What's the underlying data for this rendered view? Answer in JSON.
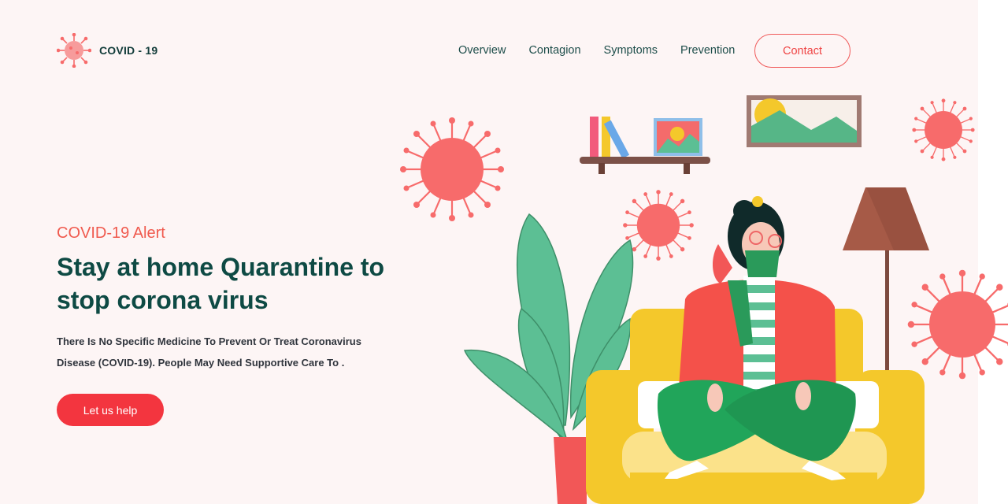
{
  "brand": {
    "name": "COVID - 19",
    "logo_icon": "virus-icon"
  },
  "nav": {
    "items": [
      "Overview",
      "Contagion",
      "Symptoms",
      "Prevention"
    ],
    "contact_label": "Contact"
  },
  "hero": {
    "eyebrow": "COVID-19 Alert",
    "title": "Stay at home Quarantine to stop corona virus",
    "description": "There Is No Specific Medicine To Prevent Or Treat Coronavirus Disease (COVID-19). People May Need Supportive Care To .",
    "cta_label": "Let us help"
  },
  "colors": {
    "accent": "#f3353f",
    "heading": "#0e4a44",
    "virus": "#f76b6b",
    "sofa": "#f4c82b",
    "plant": "#5cbf94",
    "background": "#fdf5f5"
  }
}
